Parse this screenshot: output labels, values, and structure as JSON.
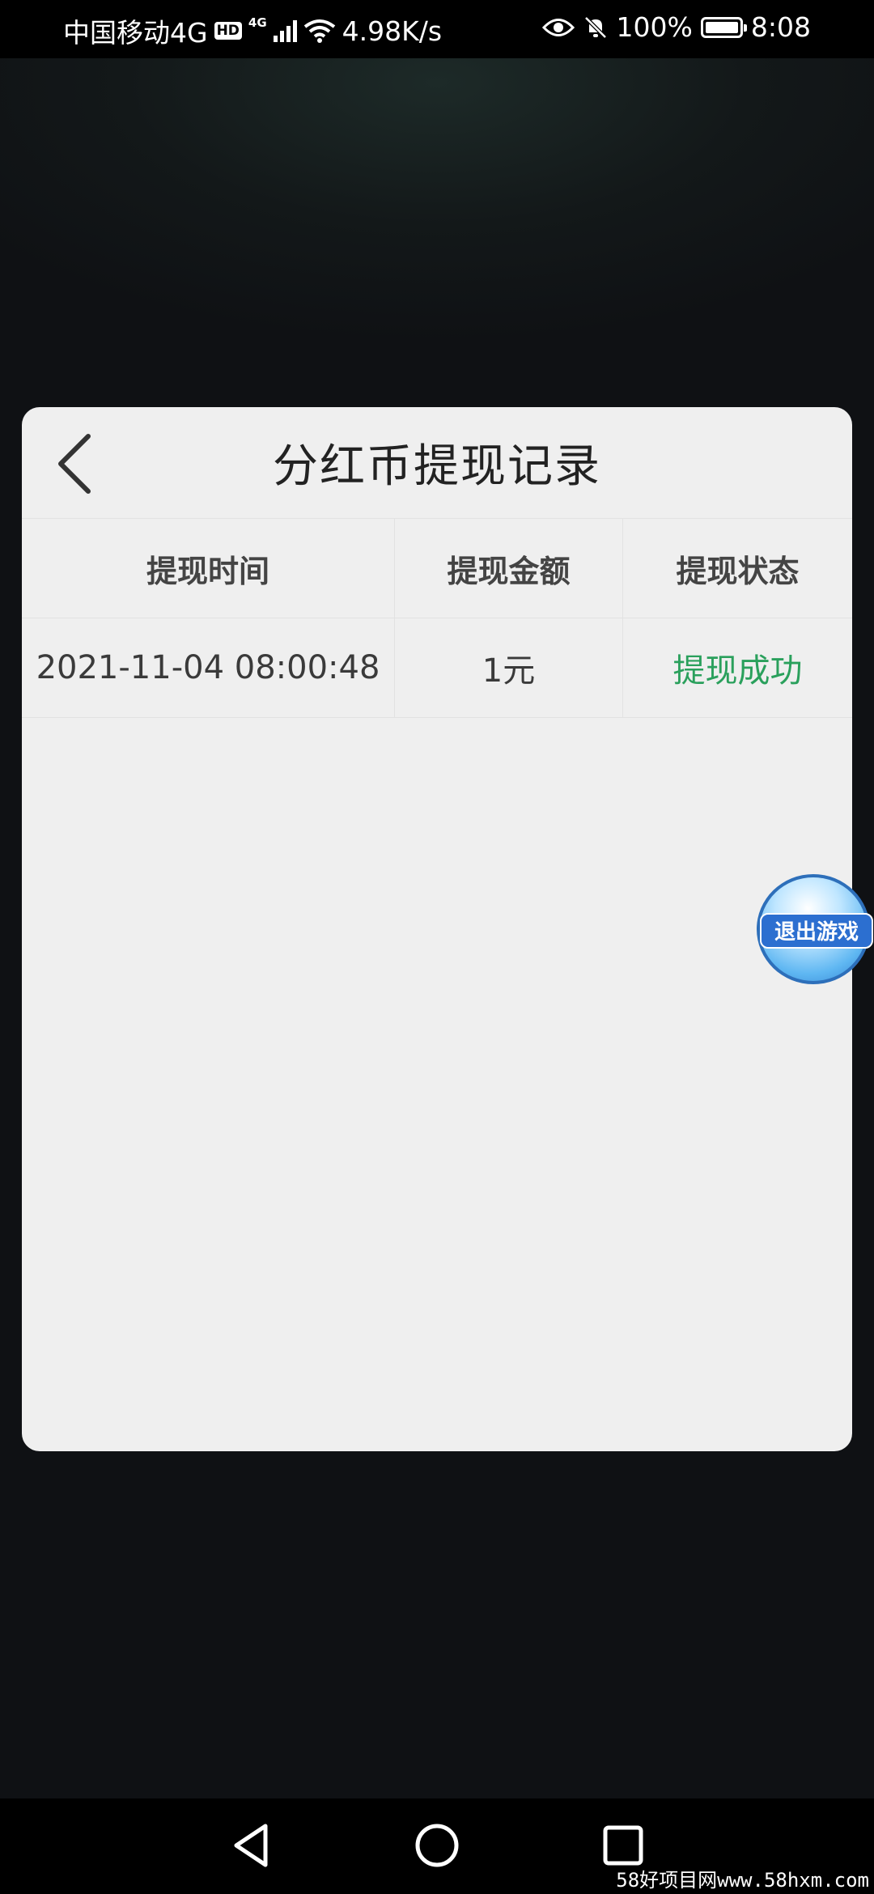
{
  "status_bar": {
    "carrier": "中国移动4G",
    "hd_badge": "HD",
    "network_type": "4G",
    "speed": "4.98K/s",
    "battery": "100%",
    "time": "8:08",
    "icons": [
      "hd-badge",
      "signal-icon",
      "wifi-icon",
      "eye-icon",
      "bell-muted-icon",
      "battery-icon"
    ]
  },
  "dialog": {
    "title": "分红币提现记录",
    "back_icon": "chevron-left-icon",
    "columns": [
      "提现时间",
      "提现金额",
      "提现状态"
    ],
    "rows": [
      {
        "time": "2021-11-04 08:00:48",
        "amount": "1元",
        "status": "提现成功"
      }
    ],
    "status_color": "#2aa05c"
  },
  "float_button": {
    "label": "退出游戏"
  },
  "nav_bar": {
    "icons": [
      "back-triangle-icon",
      "home-circle-icon",
      "recents-square-icon"
    ]
  },
  "watermark": "58好项目网www.58hxm.com"
}
